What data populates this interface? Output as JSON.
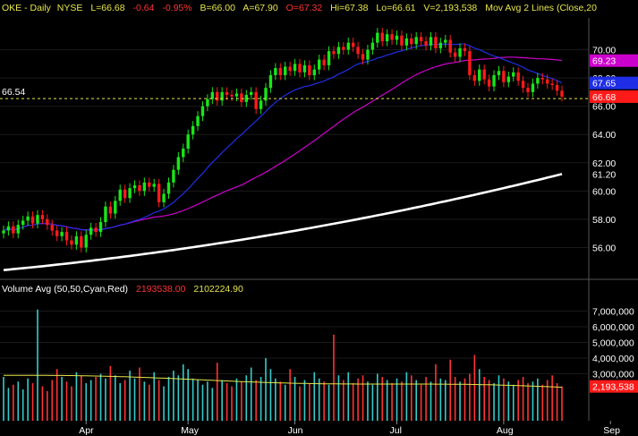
{
  "header": {
    "symbol": "OKE",
    "period": "Daily",
    "exchange": "NYSE",
    "last": "L=66.68",
    "change": "-0.64",
    "change_pct": "-0.95%",
    "bid": "B=66.00",
    "ask": "A=67.90",
    "open": "O=67.32",
    "high": "Hi=67.38",
    "low": "Lo=66.61",
    "volume": "V=2,193,538",
    "study": "Mov Avg 2 Lines (Close,20"
  },
  "volume_header": {
    "title": "Volume Avg (50,50,Cyan,Red)",
    "value1": "2193538.00",
    "value2": "2102224.90"
  },
  "reference_line": {
    "value": 66.54,
    "label": "66.54"
  },
  "price_axis": {
    "ticks": [
      56,
      58,
      60,
      62,
      64,
      66,
      68,
      70
    ],
    "tick_labels": [
      "56.00",
      "58.00",
      "60.00",
      "62.00",
      "64.00",
      "66.00",
      "68.00",
      "70.00"
    ]
  },
  "price_labels": [
    {
      "text": "69.23",
      "value": 69.23,
      "bg": "#cc00cc",
      "fg": "#ffffff"
    },
    {
      "text": "67.65",
      "value": 67.65,
      "bg": "#1f2ee6",
      "fg": "#ffffff"
    },
    {
      "text": "66.68",
      "value": 66.68,
      "bg": "#ff1a1a",
      "fg": "#ffffff"
    },
    {
      "text": "61.20",
      "value": 61.2,
      "bg": "#000000",
      "fg": "#ffffff"
    }
  ],
  "volume_axis": {
    "ticks": [
      3000000,
      4000000,
      5000000,
      6000000,
      7000000
    ],
    "tick_labels": [
      "3,000,000",
      "4,000,000",
      "5,000,000",
      "6,000,000",
      "7,000,000"
    ],
    "current_label": {
      "text": "2,193,538",
      "value": 2193538,
      "bg": "#ff1a1a",
      "fg": "#ffffff"
    }
  },
  "x_axis": {
    "labels": [
      {
        "text": "Apr",
        "index": 17
      },
      {
        "text": "May",
        "index": 38
      },
      {
        "text": "Jun",
        "index": 60
      },
      {
        "text": "Jul",
        "index": 81
      },
      {
        "text": "Aug",
        "index": 103
      },
      {
        "text": "Sep",
        "index": 125
      }
    ]
  },
  "colors": {
    "up": "#19e619",
    "down": "#ff1a1a",
    "ma20": "#1f2ee6",
    "ma50": "#cc00cc",
    "ma200": "#ffffff",
    "vol_up": "#33cccc",
    "vol_down": "#ff3333",
    "vol_avg": "#e6e64d",
    "ref": "#e6e64d"
  },
  "chart_data": {
    "type": "candlestick",
    "price_range": [
      54,
      72
    ],
    "volume_range": [
      0,
      8000000
    ],
    "start_price": 57.0,
    "closes": [
      57.2,
      57.5,
      57.0,
      57.6,
      57.9,
      58.2,
      57.7,
      58.3,
      58.0,
      57.6,
      57.2,
      56.8,
      57.1,
      56.5,
      56.2,
      56.8,
      56.0,
      56.9,
      57.4,
      57.1,
      57.8,
      58.9,
      58.4,
      59.3,
      60.1,
      59.5,
      60.2,
      60.4,
      60.0,
      60.6,
      60.3,
      60.5,
      59.2,
      59.8,
      60.6,
      61.5,
      62.4,
      63.0,
      64.0,
      64.6,
      65.3,
      66.0,
      66.5,
      67.0,
      66.4,
      67.0,
      66.8,
      66.7,
      66.9,
      66.3,
      66.8,
      67.0,
      65.8,
      66.4,
      67.3,
      68.2,
      68.7,
      68.2,
      68.8,
      68.5,
      69.0,
      68.4,
      68.9,
      68.2,
      68.6,
      69.3,
      68.9,
      69.9,
      69.7,
      70.2,
      70.0,
      70.5,
      70.2,
      69.7,
      69.3,
      70.0,
      70.5,
      71.2,
      70.6,
      71.1,
      70.7,
      71.0,
      70.3,
      70.8,
      70.4,
      70.9,
      70.6,
      70.3,
      70.9,
      70.1,
      70.5,
      70.7,
      69.8,
      69.5,
      70.1,
      69.9,
      68.2,
      67.8,
      68.6,
      67.9,
      67.4,
      68.2,
      68.5,
      67.7,
      68.1,
      68.4,
      67.8,
      67.3,
      67.0,
      67.6,
      68.0,
      67.9,
      67.6,
      67.5,
      67.1,
      66.68
    ],
    "volumes": [
      2800000,
      2100000,
      2300000,
      2500000,
      2000000,
      2700000,
      2400000,
      7100000,
      2200000,
      1900000,
      2600000,
      3300000,
      2800000,
      2500000,
      2200000,
      3100000,
      2900000,
      2400000,
      2600000,
      2800000,
      3000000,
      2700000,
      3500000,
      2900000,
      2400000,
      2600000,
      3200000,
      2700000,
      3400000,
      2500000,
      2300000,
      3100000,
      2600000,
      2200000,
      2800000,
      3200000,
      2900000,
      3600000,
      3300000,
      2700000,
      2600000,
      2300000,
      2500000,
      2100000,
      3700000,
      2600000,
      2400000,
      2200000,
      2700000,
      2500000,
      2900000,
      3400000,
      2600000,
      2800000,
      4000000,
      3300000,
      2700000,
      2500000,
      2300000,
      3300000,
      2800000,
      2200000,
      2600000,
      2400000,
      3100000,
      2700000,
      2500000,
      2300000,
      5500000,
      2900000,
      2600000,
      3100000,
      2400000,
      2700000,
      2900000,
      2500000,
      2300000,
      3000000,
      2800000,
      2600000,
      2400000,
      2700000,
      2500000,
      3100000,
      2900000,
      2600000,
      2300000,
      2800000,
      2500000,
      3600000,
      2700000,
      2600000,
      3900000,
      2800000,
      2500000,
      2700000,
      3000000,
      4200000,
      3300000,
      2800000,
      2600000,
      2400000,
      2900000,
      2700000,
      2500000,
      2300000,
      2600000,
      2800000,
      2400000,
      2500000,
      2700000,
      2300000,
      2600000,
      2900000,
      2400000,
      2193538
    ],
    "ma20_end": 67.65,
    "ma50_end": 69.23,
    "ma200_start": 54.4,
    "ma200_end": 61.2,
    "vol_avg_start": 2900000,
    "vol_avg_end": 2102224.9
  }
}
